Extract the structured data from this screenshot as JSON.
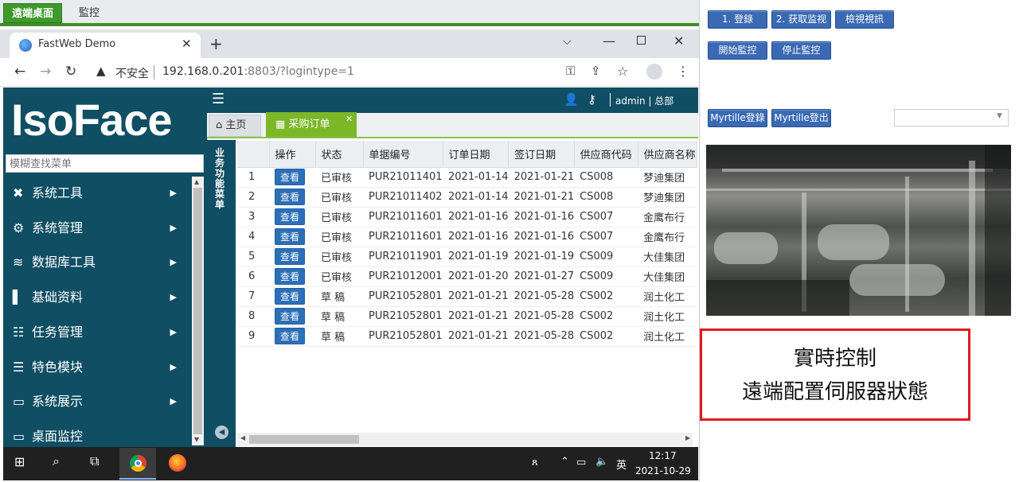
{
  "top_tabs": {
    "remote_desktop": "遠端桌面",
    "monitor": "監控"
  },
  "browser": {
    "tab_title": "FastWeb Demo",
    "insecure_label": "不安全",
    "url_host": "192.168.0.201",
    "url_rest": ":8803/?logintype=1"
  },
  "app": {
    "logo": "IsoFace",
    "user_label": "admin | 总部",
    "search_placeholder": "模糊查找菜单",
    "tabs": [
      {
        "label": "主页"
      },
      {
        "label": "采购订单"
      }
    ],
    "tree_label": "业务功能菜单",
    "menu": [
      {
        "label": "系统工具",
        "icon": "tools-icon"
      },
      {
        "label": "系统管理",
        "icon": "gear-icon"
      },
      {
        "label": "数据库工具",
        "icon": "database-icon"
      },
      {
        "label": "基础资料",
        "icon": "file-icon"
      },
      {
        "label": "任务管理",
        "icon": "tasks-icon"
      },
      {
        "label": "特色模块",
        "icon": "list-icon"
      },
      {
        "label": "系统展示",
        "icon": "monitor-icon"
      },
      {
        "label": "桌面监控",
        "icon": "monitor-icon"
      }
    ]
  },
  "table": {
    "headers": [
      "操作",
      "状态",
      "单据编号",
      "订单日期",
      "签订日期",
      "供应商代码",
      "供应商名称"
    ],
    "view_label": "查看",
    "rows": [
      {
        "n": "1",
        "status": "已审核",
        "no": "PUR21011401",
        "order_date": "2021-01-14",
        "sign_date": "2021-01-21",
        "code": "CS008",
        "name": "梦迪集团"
      },
      {
        "n": "2",
        "status": "已审核",
        "no": "PUR21011402",
        "order_date": "2021-01-14",
        "sign_date": "2021-01-21",
        "code": "CS008",
        "name": "梦迪集团"
      },
      {
        "n": "3",
        "status": "已审核",
        "no": "PUR21011601",
        "order_date": "2021-01-16",
        "sign_date": "2021-01-16",
        "code": "CS007",
        "name": "金鹰布行"
      },
      {
        "n": "4",
        "status": "已审核",
        "no": "PUR21011601",
        "order_date": "2021-01-16",
        "sign_date": "2021-01-16",
        "code": "CS007",
        "name": "金鹰布行"
      },
      {
        "n": "5",
        "status": "已审核",
        "no": "PUR21011901",
        "order_date": "2021-01-19",
        "sign_date": "2021-01-19",
        "code": "CS009",
        "name": "大佳集团"
      },
      {
        "n": "6",
        "status": "已审核",
        "no": "PUR21012001",
        "order_date": "2021-01-20",
        "sign_date": "2021-01-27",
        "code": "CS009",
        "name": "大佳集团"
      },
      {
        "n": "7",
        "status": "草 稿",
        "no": "PUR21052801",
        "order_date": "2021-01-21",
        "sign_date": "2021-05-28",
        "code": "CS002",
        "name": "润土化工"
      },
      {
        "n": "8",
        "status": "草 稿",
        "no": "PUR21052801",
        "order_date": "2021-01-21",
        "sign_date": "2021-05-28",
        "code": "CS002",
        "name": "润土化工"
      },
      {
        "n": "9",
        "status": "草 稿",
        "no": "PUR21052801",
        "order_date": "2021-01-21",
        "sign_date": "2021-05-28",
        "code": "CS002",
        "name": "润土化工"
      }
    ]
  },
  "taskbar": {
    "ime": "英",
    "time": "12:17",
    "date": "2021-10-29"
  },
  "right_panel": {
    "buttons_row1": [
      "1. 登錄",
      "2. 获取监视",
      "檢視視訊"
    ],
    "buttons_row2": [
      "開始監控",
      "停止監控"
    ],
    "buttons_row3": [
      "Myrtille登錄",
      "Myrtille登出"
    ],
    "select_value": "",
    "notice_line1": "實時控制",
    "notice_line2": "遠端配置伺服器狀態"
  },
  "colors": {
    "accent_green": "#7cb728",
    "header_teal": "#0f4e63",
    "button_blue": "#3a6ab3",
    "notice_border": "#e0191f"
  }
}
